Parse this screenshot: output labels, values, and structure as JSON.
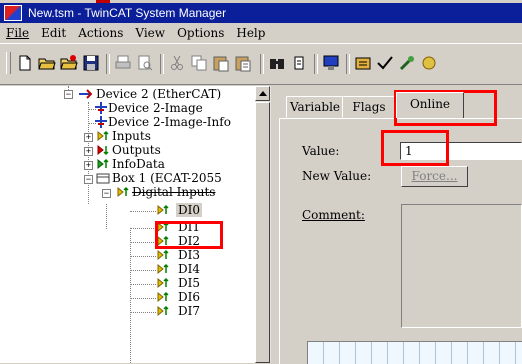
{
  "window": {
    "title": "New.tsm - TwinCAT System Manager"
  },
  "menu": [
    "File",
    "Edit",
    "Actions",
    "View",
    "Options",
    "Help"
  ],
  "toolbar_icons": [
    "new-icon",
    "open-icon",
    "open-recent-icon",
    "save-icon",
    "print-icon",
    "print-preview-icon",
    "cut-icon",
    "copy-icon",
    "paste-icon",
    "paste-special-icon",
    "find-icon",
    "find-next-icon",
    "generate-mappings-icon",
    "check-configuration-icon",
    "activate-configuration-icon",
    "restart-icon"
  ],
  "tree": {
    "device2": "Device 2 (EtherCAT)",
    "device2_image": "Device 2-Image",
    "device2_image_info": "Device 2-Image-Info",
    "inputs": "Inputs",
    "outputs": "Outputs",
    "infodata": "InfoData",
    "box1": "Box 1 (ECAT-2055",
    "digital_inputs": "Digital Inputs",
    "channels": [
      "DI0",
      "DI1",
      "DI2",
      "DI3",
      "DI4",
      "DI5",
      "DI6",
      "DI7"
    ]
  },
  "tabs": {
    "variable": "Variable",
    "flags": "Flags",
    "online": "Online",
    "active": "online"
  },
  "online": {
    "value_label": "Value:",
    "value": "1",
    "new_value_label": "New Value:",
    "force_button": "Force...",
    "comment_label": "Comment:"
  },
  "colors": {
    "titlebar": "#0b1f9a",
    "highlight": "#ff0000",
    "face": "#d4d0c8"
  }
}
